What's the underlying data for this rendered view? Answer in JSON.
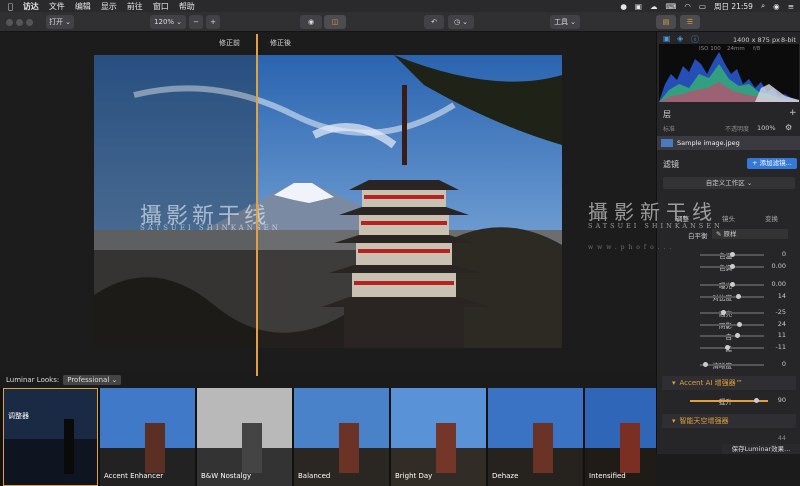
{
  "menubar": {
    "items": [
      "访达",
      "文件",
      "编辑",
      "显示",
      "前往",
      "窗口",
      "帮助"
    ],
    "clock": "周日 21:59"
  },
  "toolbar": {
    "open_label": "打开",
    "zoom_label": "120%",
    "minus_label": "−",
    "plus_label": "+",
    "tools_label": "工具"
  },
  "compare": {
    "before_label": "修正前",
    "after_label": "修正後"
  },
  "watermark": {
    "title": "攝影新干线",
    "subtitle": "SATSUEI SHINKANSEN",
    "url": "www.phofo..."
  },
  "looks": {
    "label": "Luminar Looks:",
    "selected": "Professional",
    "items": [
      {
        "name": "调整器"
      },
      {
        "name": "Accent Enhancer"
      },
      {
        "name": "B&W Nostalgy"
      },
      {
        "name": "Balanced"
      },
      {
        "name": "Bright Day"
      },
      {
        "name": "Dehaze"
      },
      {
        "name": "Intensified"
      }
    ]
  },
  "sidebar": {
    "image_info": "1400 x 875 px",
    "bit_depth": "8-bit",
    "exif": [
      "ISO 100",
      "24mm",
      "f/8"
    ],
    "layers_title": "层",
    "layer_normal": "标准",
    "layer_opacity_label": "不透明度",
    "layer_opacity_value": "100%",
    "layer_name": "Sample image.jpeg",
    "filters_title": "滤镜",
    "add_filter_label": "+ 添加滤镜...",
    "workspace_label": "自定义工作区",
    "tabs": [
      "调整",
      "镜头",
      "变换"
    ],
    "wb_label": "白平衡",
    "wb_value": "原样",
    "sliders": [
      {
        "name": "色温",
        "value": "0"
      },
      {
        "name": "色调",
        "value": "0.00"
      },
      {
        "name": "曝光",
        "value": "0.00"
      },
      {
        "name": "对比度",
        "value": "14"
      },
      {
        "name": "高亮",
        "value": "-25"
      },
      {
        "name": "阴影",
        "value": "24"
      },
      {
        "name": "白",
        "value": "11"
      },
      {
        "name": "黑",
        "value": "-11"
      },
      {
        "name": "清晰度",
        "value": "0"
      }
    ],
    "accent_section": "Accent AI 增强器™",
    "boost_label": "提升",
    "boost_value": "90",
    "sky_section": "智能天空增强器",
    "sky_value": "44",
    "save_label": "保存Luminar效果..."
  },
  "colors": {
    "accent": "#e2a13c",
    "add_filter_button": "#3478d8"
  }
}
